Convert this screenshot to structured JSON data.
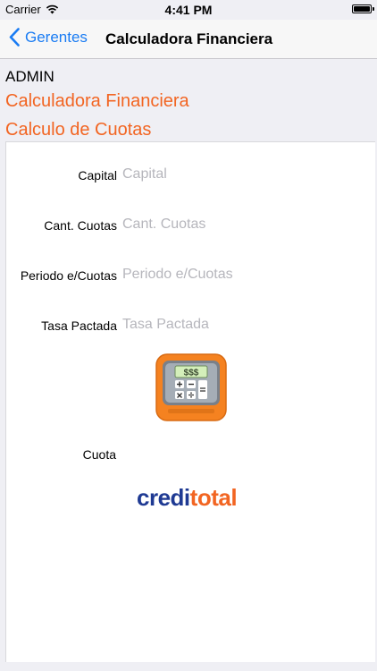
{
  "status_bar": {
    "carrier": "Carrier",
    "time": "4:41 PM"
  },
  "nav": {
    "back_label": "Gerentes",
    "title": "Calculadora Financiera"
  },
  "header": {
    "user": "ADMIN",
    "title": "Calculadora Financiera",
    "subtitle": "Calculo de Cuotas"
  },
  "form": {
    "capital": {
      "label": "Capital",
      "placeholder": "Capital"
    },
    "cant_cuotas": {
      "label": "Cant. Cuotas",
      "placeholder": "Cant. Cuotas"
    },
    "periodo": {
      "label": "Periodo e/Cuotas",
      "placeholder": "Periodo e/Cuotas"
    },
    "tasa": {
      "label": "Tasa Pactada",
      "placeholder": "Tasa Pactada"
    },
    "calc_display": "$$$",
    "cuota_label": "Cuota"
  },
  "logo": {
    "part1": "credi",
    "part2": "total"
  },
  "colors": {
    "accent": "#f26522",
    "link": "#1a7cf3",
    "brand_blue": "#1f3a93"
  }
}
